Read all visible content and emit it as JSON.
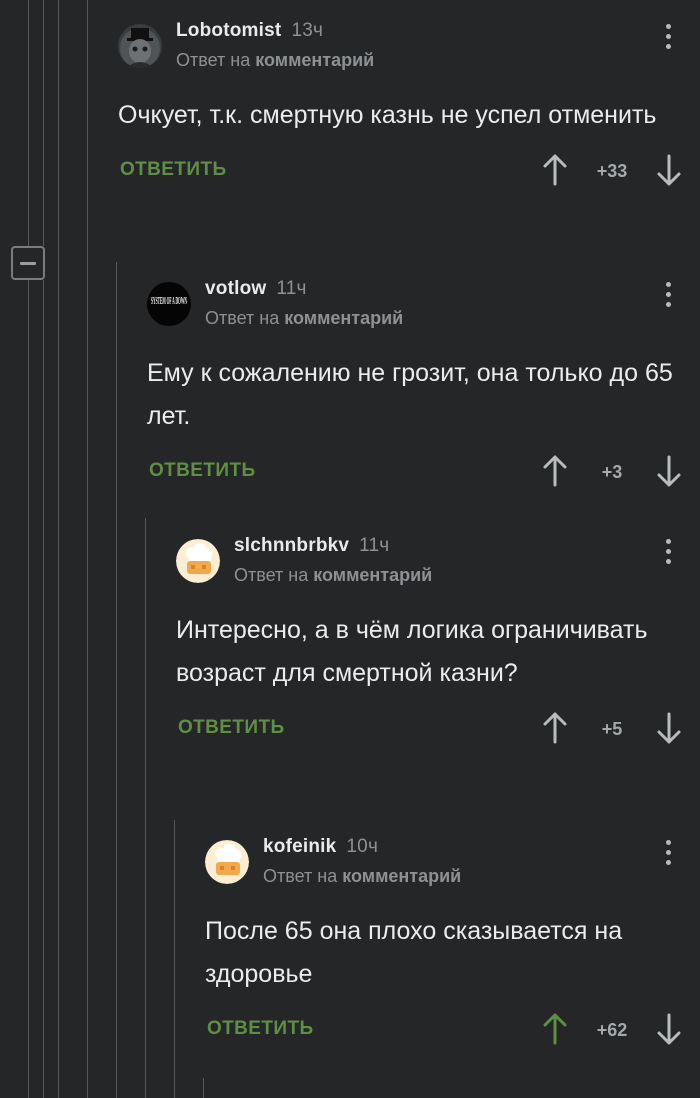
{
  "colors": {
    "background": "#242627",
    "reply_green": "#5f8f45",
    "upvote_active": "#5f8f45",
    "muted": "#8e9194"
  },
  "comments": [
    {
      "username": "Lobotomist",
      "time": "13ч",
      "reply_prefix": "Ответ на",
      "reply_target": "комментарий",
      "text": "Очкует, т.к. смертную казнь не успел отменить",
      "reply_label": "ОТВЕТИТЬ",
      "score": "+33",
      "avatar_icon": "dark-hooded-figure-avatar",
      "upvoted": false
    },
    {
      "username": "votlow",
      "time": "11ч",
      "reply_prefix": "Ответ на",
      "reply_target": "комментарий",
      "text": "Ему к сожалению не грозит, она только до 65 лет.",
      "reply_label": "ОТВЕТИТЬ",
      "score": "+3",
      "avatar_icon": "system-of-a-down-logo-avatar",
      "avatar_logo_text": "SYSTEM OF A DOWN",
      "upvoted": false
    },
    {
      "username": "slchnnbrbkv",
      "time": "11ч",
      "reply_prefix": "Ответ на",
      "reply_target": "комментарий",
      "text": "Интересно, а в чём логика ограничивать возраст для смертной казни?",
      "reply_label": "ОТВЕТИТЬ",
      "score": "+5",
      "avatar_icon": "chef-hat-default-avatar",
      "upvoted": false
    },
    {
      "username": "kofeinik",
      "time": "10ч",
      "reply_prefix": "Ответ на",
      "reply_target": "комментарий",
      "text": "После 65 она плохо сказывается на здоровье",
      "reply_label": "ОТВЕТИТЬ",
      "score": "+62",
      "avatar_icon": "chef-hat-default-avatar",
      "upvoted": true
    }
  ]
}
